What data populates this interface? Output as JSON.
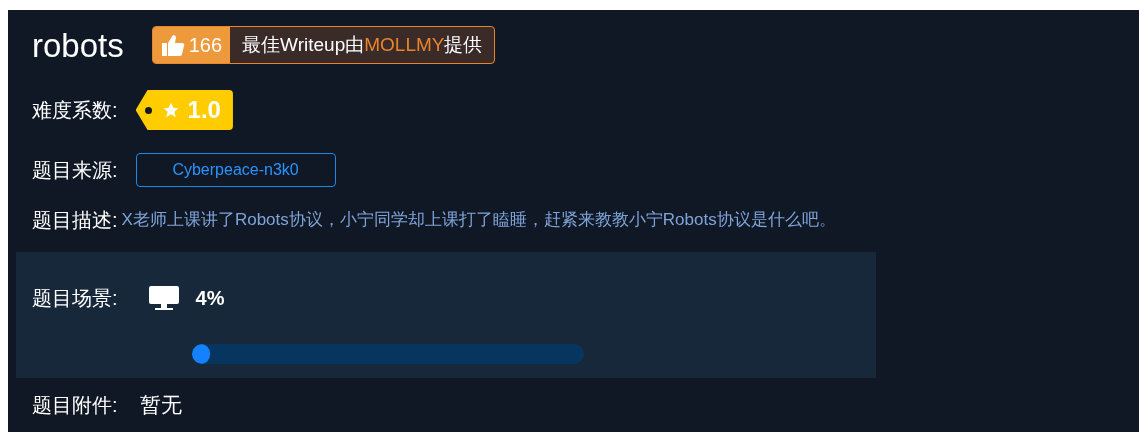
{
  "title": "robots",
  "likes": {
    "count": "166",
    "prefix": "最佳Writeup由",
    "author": "MOLLMY",
    "suffix": "提供"
  },
  "difficulty": {
    "label": "难度系数:",
    "value": "1.0"
  },
  "source": {
    "label": "题目来源:",
    "value": "Cyberpeace-n3k0"
  },
  "description": {
    "label": "题目描述:",
    "text": "X老师上课讲了Robots协议，小宁同学却上课打了瞌睡，赶紧来教教小宁Robots协议是什么吧。"
  },
  "scene": {
    "label": "题目场景:",
    "percent": "4%",
    "level": 0.04
  },
  "attachment": {
    "label": "题目附件:",
    "value": "暂无"
  }
}
